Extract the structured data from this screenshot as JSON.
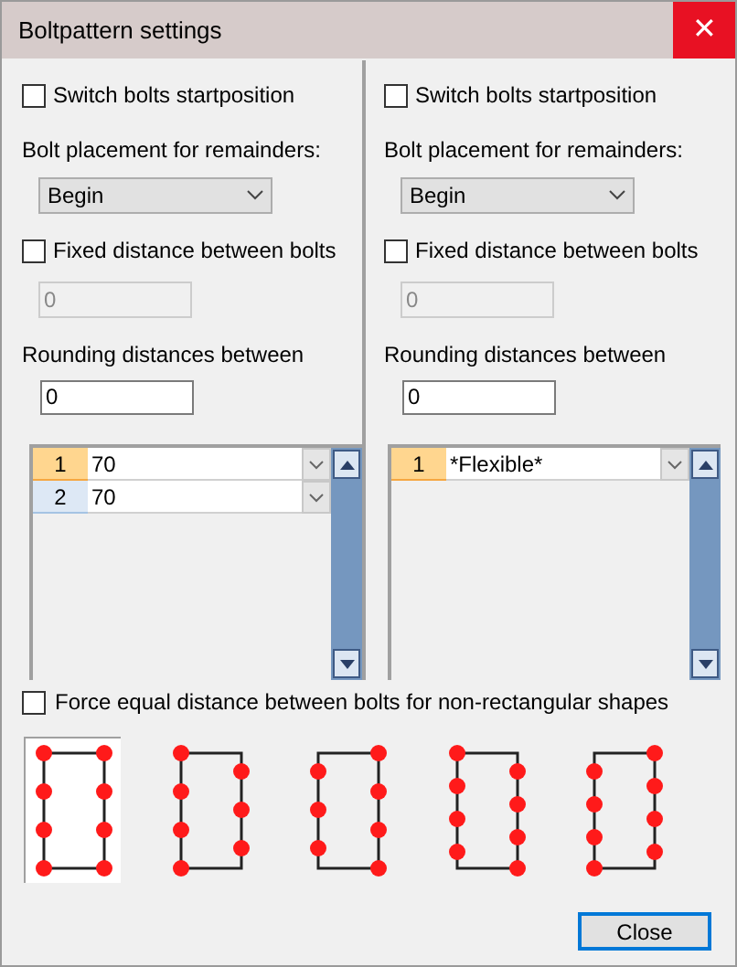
{
  "window": {
    "title": "Boltpattern settings",
    "close": "✕"
  },
  "panels": [
    {
      "switch_start": {
        "label": "Switch bolts startposition",
        "checked": false
      },
      "placement_label": "Bolt placement for remainders:",
      "placement": "Begin",
      "fixed": {
        "label": "Fixed distance between bolts",
        "checked": false
      },
      "fixed_value": {
        "value": "0",
        "disabled": true
      },
      "rounding_label": "Rounding distances between",
      "rounding_value": "0",
      "rows": [
        {
          "index": "1",
          "value": "70",
          "selected": true
        },
        {
          "index": "2",
          "value": "70",
          "selected": false
        }
      ]
    },
    {
      "switch_start": {
        "label": "Switch bolts startposition",
        "checked": false
      },
      "placement_label": "Bolt placement for remainders:",
      "placement": "Begin",
      "fixed": {
        "label": "Fixed distance between bolts",
        "checked": false
      },
      "fixed_value": {
        "value": "0",
        "disabled": true
      },
      "rounding_label": "Rounding distances between",
      "rounding_value": "0",
      "rows": [
        {
          "index": "1",
          "value": "*Flexible*",
          "selected": true
        }
      ]
    }
  ],
  "force_equal": {
    "label": "Force equal distance between bolts for non-rectangular shapes",
    "checked": false
  },
  "patterns": [
    {
      "selected": true
    },
    {
      "selected": false
    },
    {
      "selected": false
    },
    {
      "selected": false
    },
    {
      "selected": false
    }
  ],
  "buttons": [
    "Close"
  ]
}
